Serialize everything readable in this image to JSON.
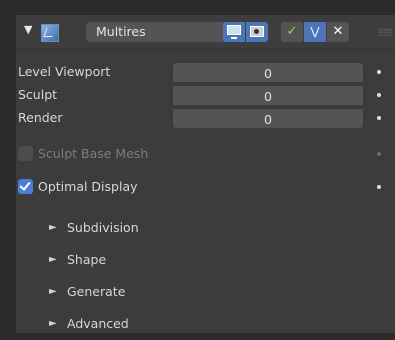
{
  "header": {
    "collapse_icon": "triangle-down-icon",
    "modifier_icon": "multires-modifier-icon",
    "name": "Multires",
    "viewport_icon": "monitor-icon",
    "render_icon": "camera-icon",
    "cage_icon": "check-icon",
    "editmode_icon": "chevron-down-icon",
    "close_icon": "close-icon"
  },
  "levels": [
    {
      "label": "Level Viewport",
      "value": "0"
    },
    {
      "label": "Sculpt",
      "value": "0"
    },
    {
      "label": "Render",
      "value": "0"
    }
  ],
  "sculpt_base_mesh": {
    "label": "Sculpt Base Mesh",
    "checked": false,
    "enabled": false
  },
  "optimal_display": {
    "label": "Optimal Display",
    "checked": true
  },
  "subpanels": [
    {
      "label": "Subdivision",
      "icon": "triangle-right-icon"
    },
    {
      "label": "Shape",
      "icon": "triangle-right-icon"
    },
    {
      "label": "Generate",
      "icon": "triangle-right-icon"
    },
    {
      "label": "Advanced",
      "icon": "triangle-right-icon"
    }
  ],
  "colors": {
    "panel_bg": "#3c3c3c",
    "field_bg": "#545454",
    "accent": "#4a7ed8",
    "toggle_active": "#4b76b8",
    "check_green": "#7ee05a"
  }
}
